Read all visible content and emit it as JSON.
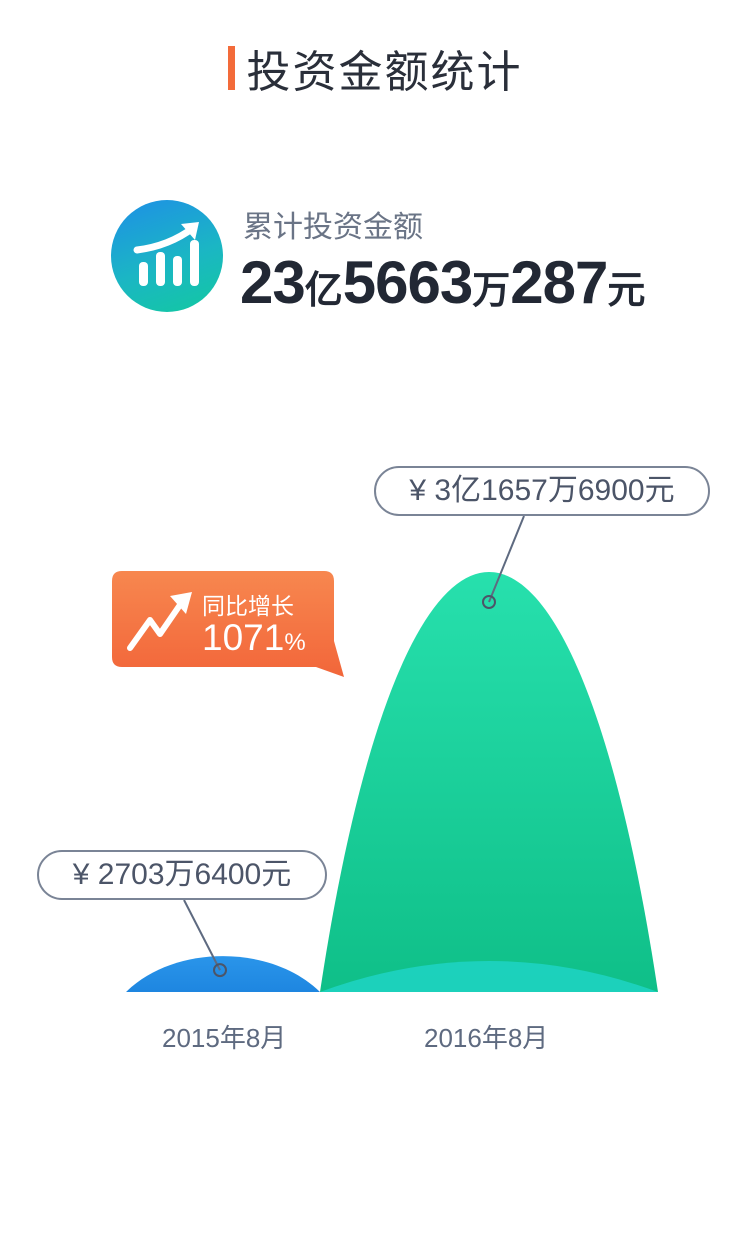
{
  "header": {
    "title": "投资金额统计"
  },
  "summary": {
    "label": "累计投资金额",
    "amount_parts": [
      "23",
      "亿",
      "5663",
      "万",
      "287",
      "元"
    ],
    "icon": "growth-chart-icon",
    "icon_colors": [
      "#1e8fe6",
      "#12c9a0"
    ]
  },
  "growth_badge": {
    "label": "同比增长",
    "value": "1071",
    "unit": "%",
    "icon": "trend-up-arrow-icon",
    "color": "#f36b3a"
  },
  "chart_data": {
    "type": "area",
    "categories": [
      "2015年8月",
      "2016年8月"
    ],
    "values": [
      27036400,
      316576900
    ],
    "value_labels": [
      "¥ 2703万6400元",
      "¥ 3亿1657万6900元"
    ],
    "colors": [
      "#1e8fe6",
      "#1fd8a6"
    ]
  }
}
